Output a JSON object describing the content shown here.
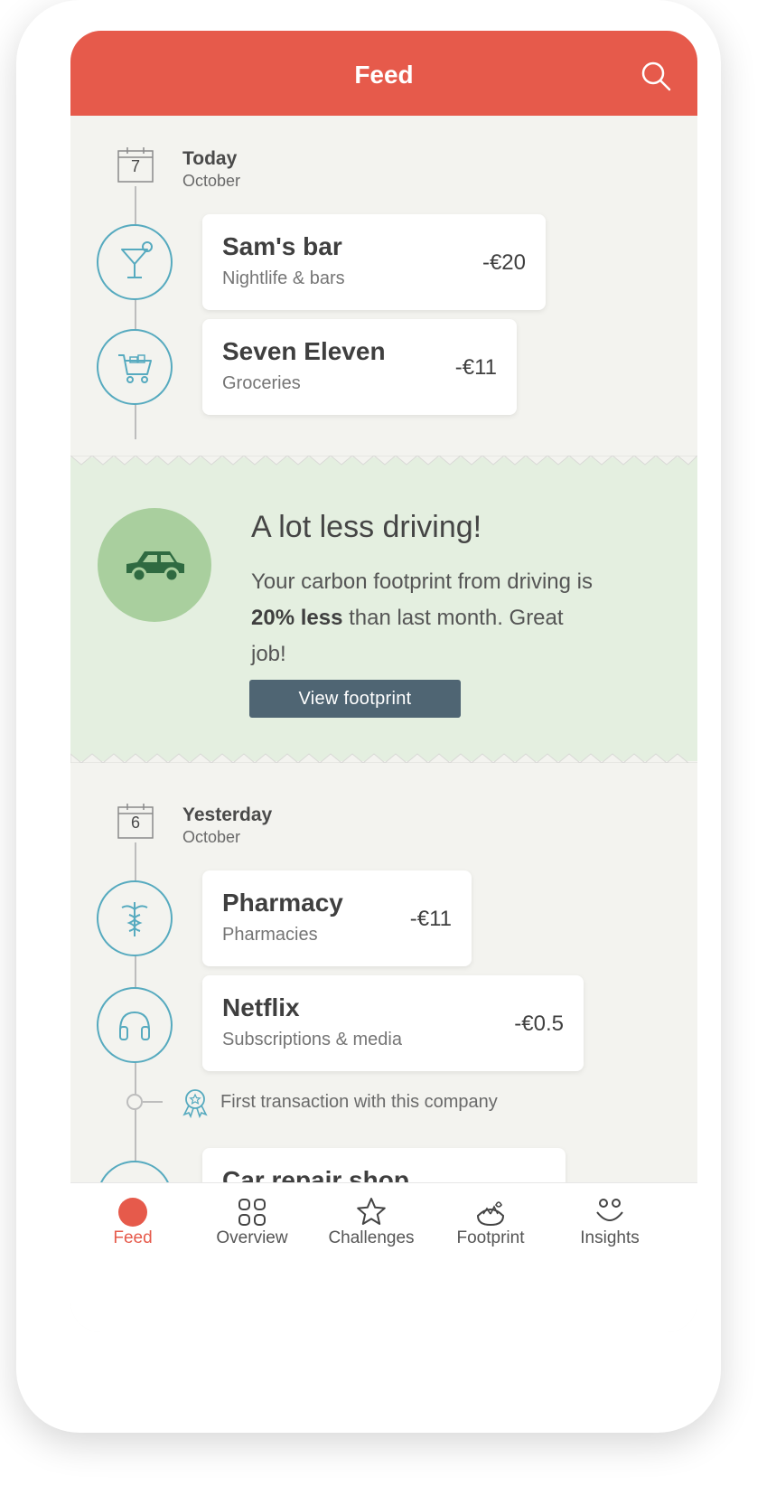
{
  "header": {
    "title": "Feed"
  },
  "days": [
    {
      "day_number": "7",
      "title": "Today",
      "subtitle": "October",
      "transactions": [
        {
          "name": "Sam's bar",
          "category": "Nightlife & bars",
          "amount": "-€20",
          "icon": "cocktail-icon"
        },
        {
          "name": "Seven Eleven",
          "category": "Groceries",
          "amount": "-€11",
          "icon": "shopping-cart-icon"
        }
      ]
    },
    {
      "day_number": "6",
      "title": "Yesterday",
      "subtitle": "October",
      "transactions": [
        {
          "name": "Pharmacy",
          "category": "Pharmacies",
          "amount": "-€11",
          "icon": "caduceus-icon"
        },
        {
          "name": "Netflix",
          "category": "Subscriptions & media",
          "amount": "-€0.5",
          "icon": "headphones-icon"
        },
        {
          "name": "Car repair shop",
          "category": "",
          "amount": "",
          "icon": "car-repair-icon"
        }
      ],
      "note": {
        "text": "First transaction with this company",
        "icon": "award-ribbon-icon"
      }
    }
  ],
  "insight": {
    "title": "A lot less driving!",
    "body_before": "Your carbon footprint from driving is ",
    "body_bold": "20% less",
    "body_after": " than last month. Great job!",
    "button_label": "View footprint",
    "icon": "car-icon"
  },
  "tabs": [
    {
      "label": "Feed",
      "icon": "dot-icon",
      "active": true
    },
    {
      "label": "Overview",
      "icon": "grid-icon",
      "active": false
    },
    {
      "label": "Challenges",
      "icon": "star-icon",
      "active": false
    },
    {
      "label": "Footprint",
      "icon": "footprint-icon",
      "active": false
    },
    {
      "label": "Insights",
      "icon": "smiley-icon",
      "active": false
    }
  ],
  "colors": {
    "brand": "#e65a4b",
    "accent_blue": "#56aabf",
    "insight_bg": "#e4efe0",
    "insight_circle": "#a9cf9e",
    "car_green": "#2f6a41",
    "button_bg": "#4f6573"
  }
}
